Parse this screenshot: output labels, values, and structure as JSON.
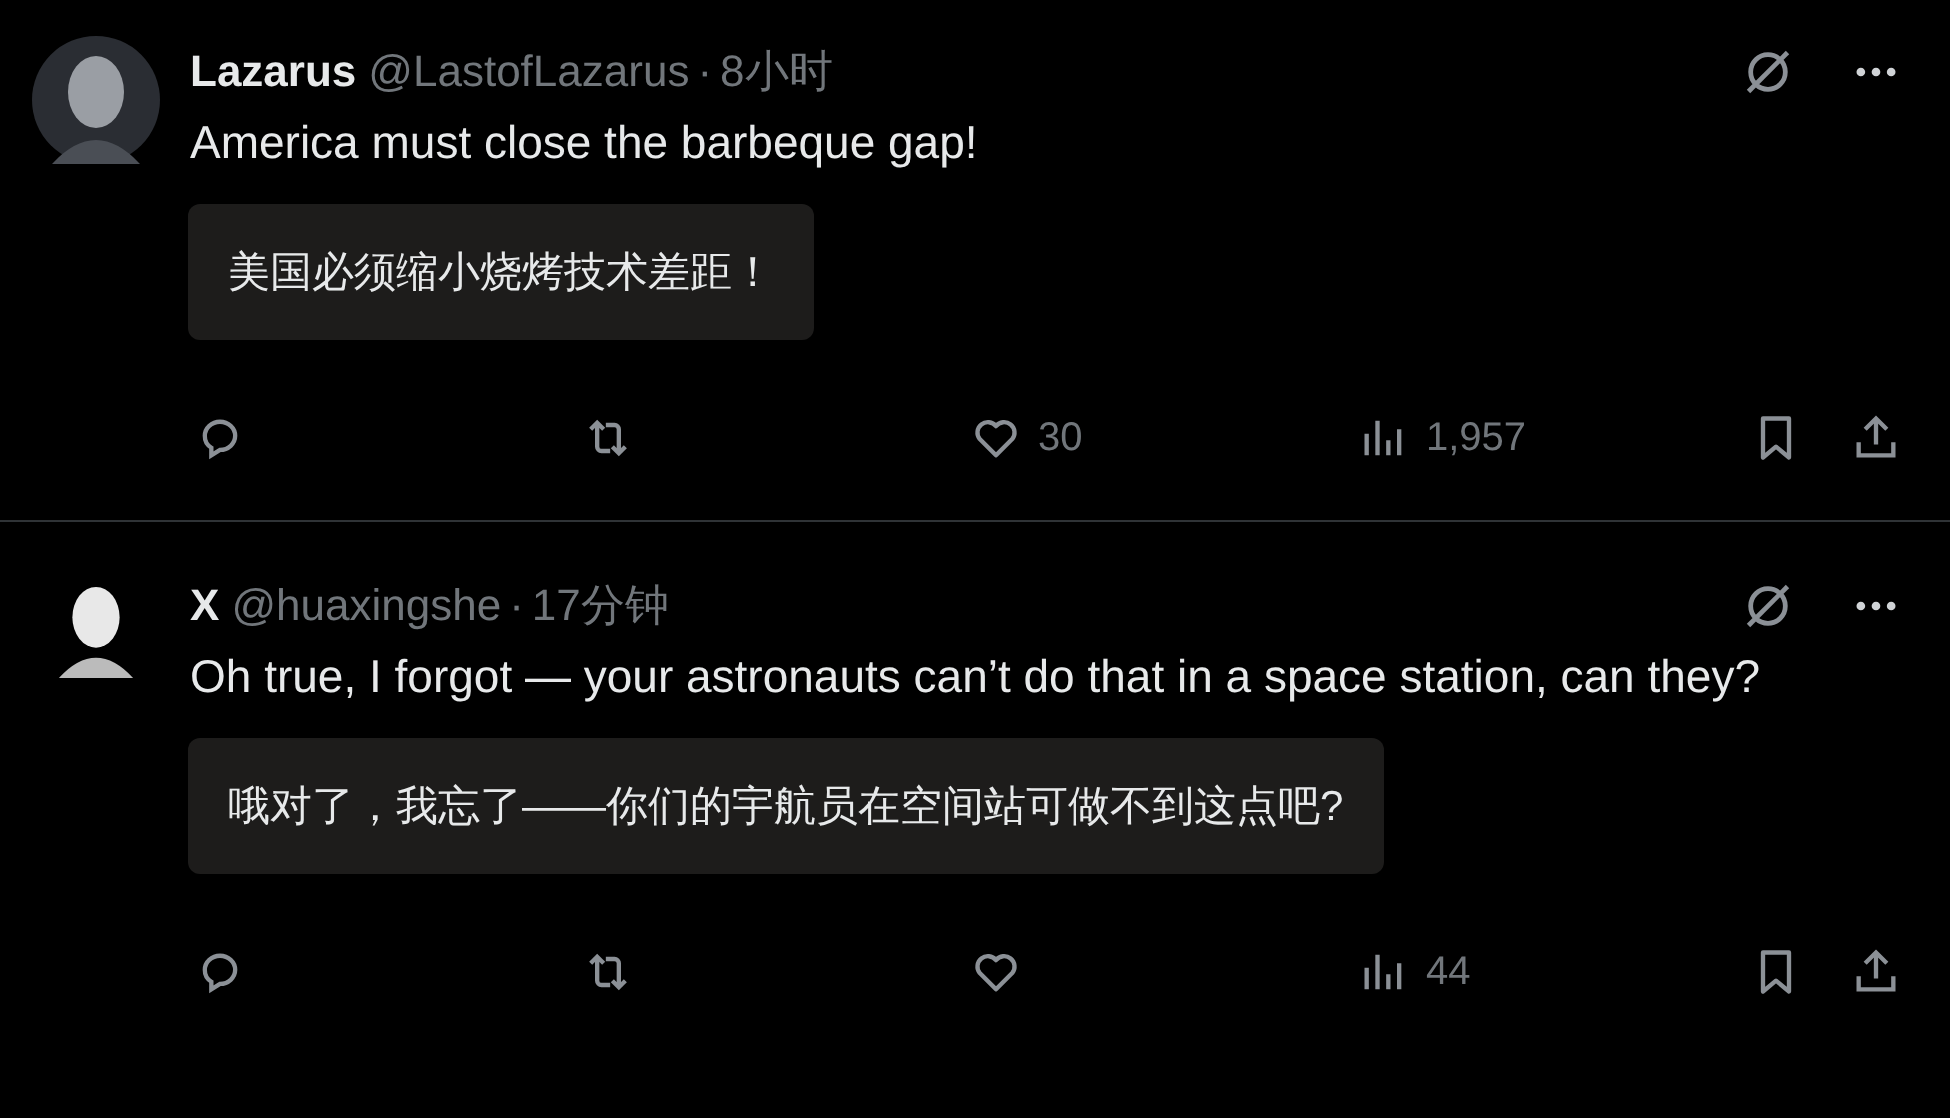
{
  "posts": [
    {
      "name": "Lazarus",
      "handle": "@LastofLazarus",
      "separator": "·",
      "time": "8小时",
      "avatar": {
        "kind": "dark"
      },
      "text": "America must close the barbeque gap!",
      "translation": "美国必须缩小烧烤技术差距！",
      "likes": "30",
      "views": "1,957"
    },
    {
      "name": "X",
      "handle": "@huaxingshe",
      "separator": "·",
      "time": "17分钟",
      "avatar": {
        "kind": "light"
      },
      "text": "Oh true, I forgot — your astronauts can’t do that in a space station, can they?",
      "translation": "哦对了，我忘了——你们的宇航员在空间站可做不到这点吧?",
      "views": "44"
    }
  ]
}
